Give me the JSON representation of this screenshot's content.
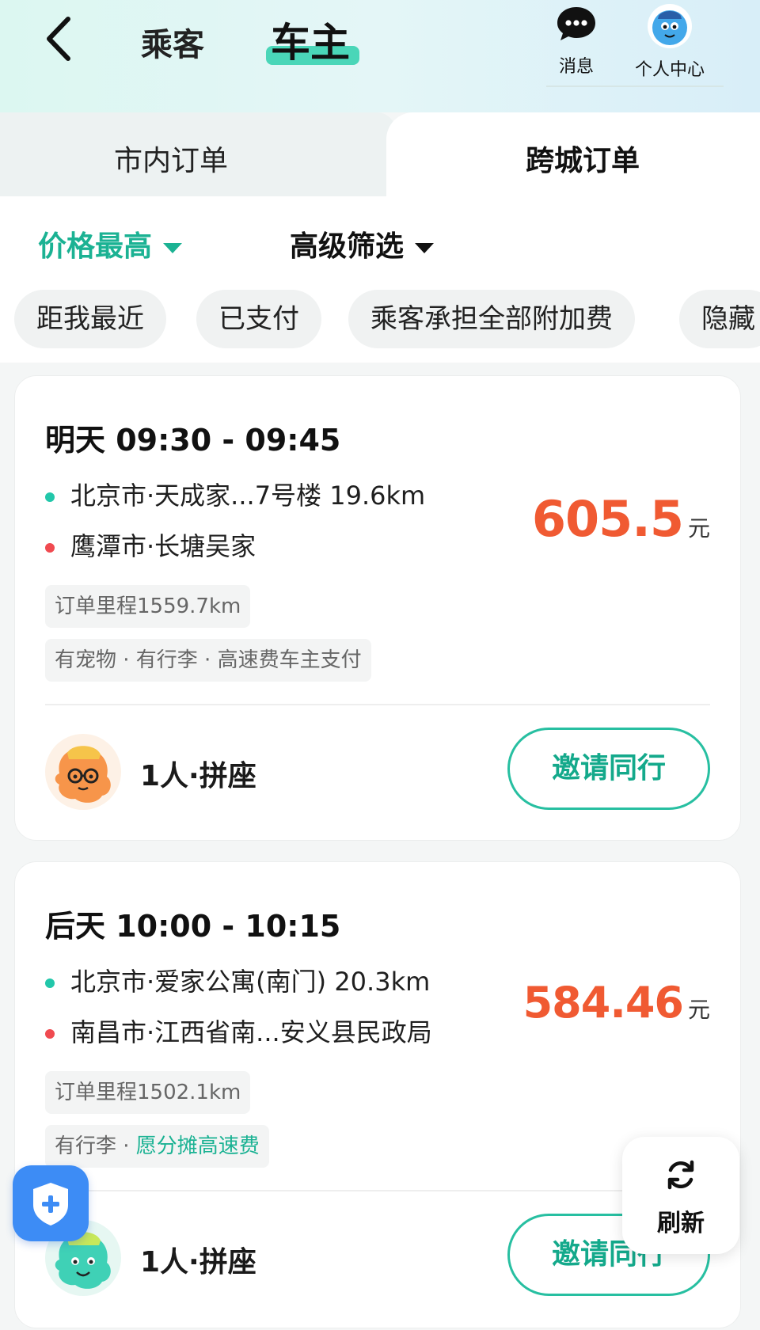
{
  "header": {
    "back_icon": "chevron-left-icon",
    "role_tabs": [
      {
        "label": "乘客",
        "active": false
      },
      {
        "label": "车主",
        "active": true
      }
    ],
    "actions": {
      "messages_label": "消息",
      "profile_label": "个人中心"
    },
    "accent_color": "#4ad6b8"
  },
  "order_tabs": [
    {
      "label": "市内订单",
      "active": false
    },
    {
      "label": "跨城订单",
      "active": true
    }
  ],
  "sort": {
    "price_label": "价格最高",
    "filter_label": "高级筛选"
  },
  "chips": [
    "距我最近",
    "已支付",
    "乘客承担全部附加费",
    "隐藏"
  ],
  "orders": [
    {
      "time": "明天 09:30 - 09:45",
      "from": "北京市·天成家...7号楼 19.6km",
      "to": "鹰潭市·长塘吴家",
      "price": "605.5",
      "unit": "元",
      "mileage": "订单里程1559.7km",
      "extras": "有宠物 · 有行李 · 高速费车主支付",
      "extras_highlight": "",
      "seats": "1人·拼座",
      "invite_label": "邀请同行"
    },
    {
      "time": "后天 10:00 - 10:15",
      "from": "北京市·爱家公寓(南门) 20.3km",
      "to": "南昌市·江西省南...安义县民政局",
      "price": "584.46",
      "unit": "元",
      "mileage": "订单里程1502.1km",
      "extras": "有行李 · ",
      "extras_highlight": "愿分摊高速费",
      "seats": "1人·拼座",
      "invite_label": "邀请同行"
    }
  ],
  "floating": {
    "shield_icon": "shield-plus-icon",
    "refresh_label": "刷新"
  },
  "colors": {
    "primary_green": "#1bb293",
    "price_orange": "#f05a32",
    "start_dot": "#22c7aa",
    "end_dot": "#f04a50"
  }
}
